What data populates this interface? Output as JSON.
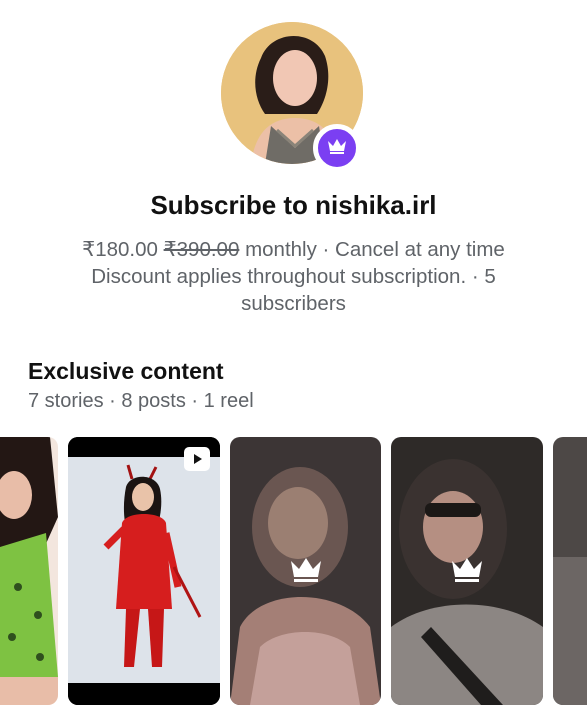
{
  "header": {
    "title": "Subscribe to nishika.irl",
    "price": "₹180.00",
    "original_price": "₹390.00",
    "billing_text": "monthly · Cancel at any time",
    "discount_text": "Discount applies throughout subscription. · 5 subscribers"
  },
  "exclusive": {
    "title": "Exclusive content",
    "subtitle": "7 stories · 8 posts · 1 reel"
  },
  "colors": {
    "badge": "#7b3ff2",
    "muted_text": "#5f6368"
  },
  "icons": {
    "badge": "crown-icon",
    "video": "play-icon",
    "locked": "crown-icon"
  }
}
